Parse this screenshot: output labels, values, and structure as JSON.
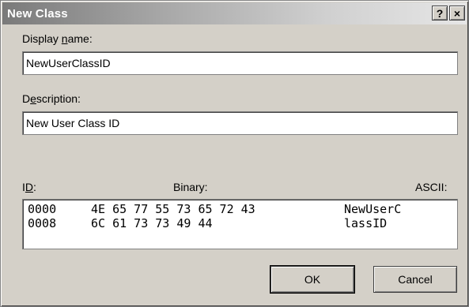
{
  "window": {
    "title": "New Class",
    "help_label": "?",
    "close_label": "×"
  },
  "display_name": {
    "label_pre": "Display ",
    "label_key": "n",
    "label_post": "ame:",
    "value": "NewUserClassID"
  },
  "description": {
    "label_pre": "D",
    "label_key": "e",
    "label_post": "scription:",
    "value": "New User Class ID"
  },
  "binary_editor": {
    "id_label_pre": "I",
    "id_label_key": "D",
    "id_label_post": ":",
    "binary_label": "Binary:",
    "ascii_label": "ASCII:",
    "rows": [
      {
        "offset": "0000",
        "bytes": "4E 65 77 55 73 65 72 43",
        "ascii": "NewUserC"
      },
      {
        "offset": "0008",
        "bytes": "6C 61 73 73 49 44",
        "ascii": "lassID"
      }
    ]
  },
  "buttons": {
    "ok": "OK",
    "cancel": "Cancel"
  }
}
